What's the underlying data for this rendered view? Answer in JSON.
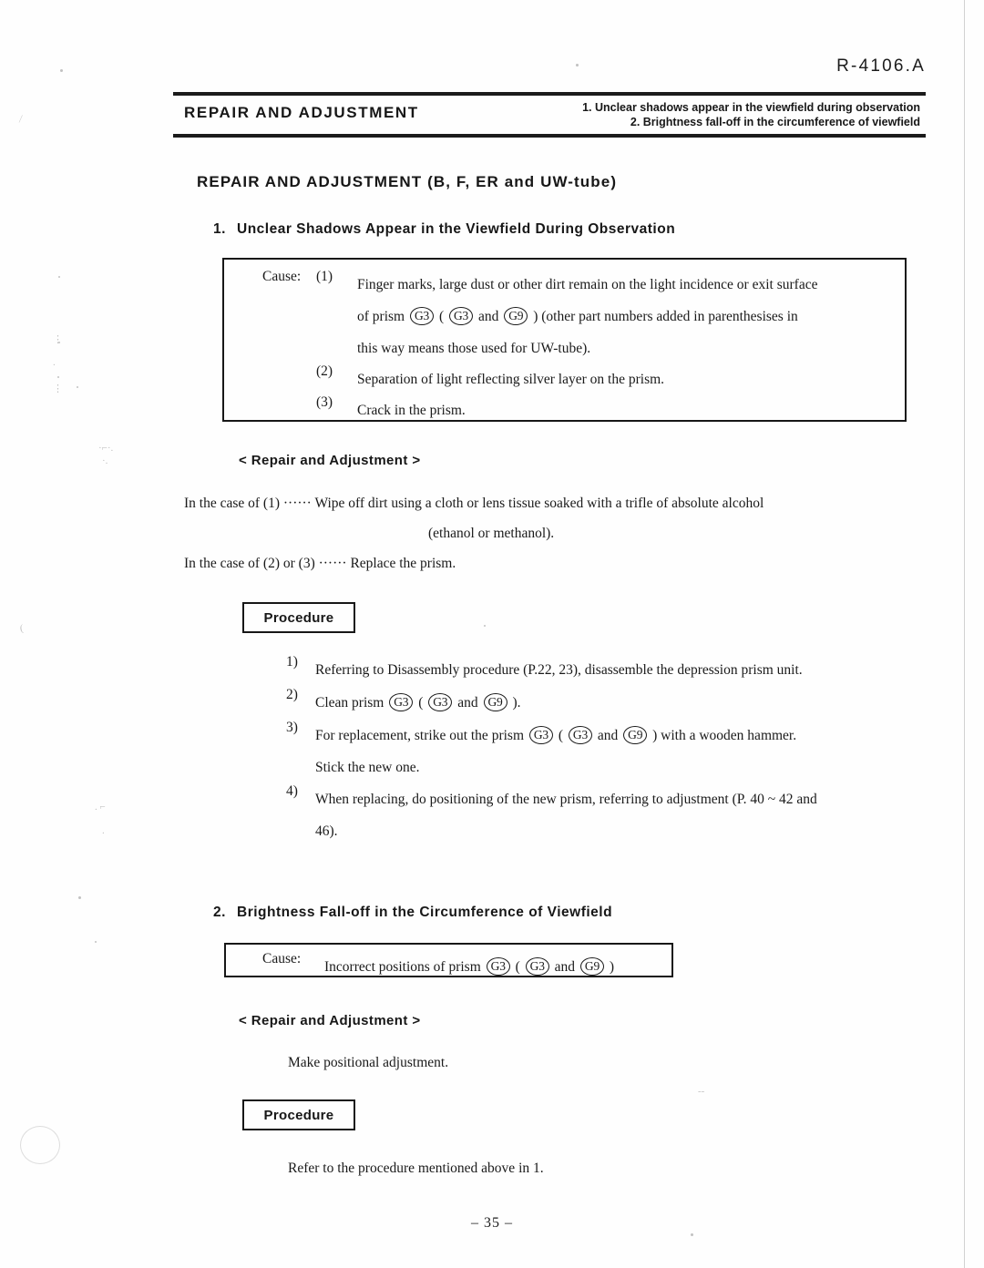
{
  "document": {
    "code": "R-4106.A",
    "page_number": "– 35 –"
  },
  "header": {
    "left_title": "REPAIR  AND  ADJUSTMENT",
    "right_line1": "1. Unclear shadows appear in the viewfield during observation",
    "right_line2": "2. Brightness fall-off in the circumference of viewfield"
  },
  "main_heading": "REPAIR  AND  ADJUSTMENT  (B, F, ER and UW-tube)",
  "section1": {
    "number": "1.",
    "title": "Unclear Shadows Appear in the Viewfield During Observation",
    "cause_box": {
      "label": "Cause:",
      "items": [
        {
          "marker": "(1)",
          "line1_a": "Finger marks, large dust or other dirt remain on the light incidence or exit surface",
          "line2_a": "of prism",
          "line2_g1": "G3",
          "line2_b": "(",
          "line2_g2": "G3",
          "line2_c": "and",
          "line2_g3": "G9",
          "line2_d": ") (other part numbers added in parenthesises in",
          "line3_a": "this way means those used for UW-tube)."
        },
        {
          "marker": "(2)",
          "line1_a": "Separation of light reflecting silver layer on the prism."
        },
        {
          "marker": "(3)",
          "line1_a": "Crack in the prism."
        }
      ]
    },
    "repair_heading": "< Repair and Adjustment >",
    "repair_line1": "In the case of (1) ······ Wipe off dirt using a cloth or lens tissue soaked with a trifle of absolute alcohol",
    "repair_line2": "(ethanol or methanol).",
    "repair_line3": "In the case of (2) or (3) ······ Replace the prism.",
    "procedure_label": "Procedure",
    "procedure_steps": [
      {
        "marker": "1)",
        "line1_a": "Referring to Disassembly procedure (P.22, 23), disassemble the depression prism unit."
      },
      {
        "marker": "2)",
        "line1_a": "Clean prism",
        "g1": "G3",
        "mid1": "(",
        "g2": "G3",
        "mid2": "and",
        "g3": "G9",
        "tail": ")."
      },
      {
        "marker": "3)",
        "line1_a": "For replacement, strike out the prism",
        "g1": "G3",
        "mid1": "(",
        "g2": "G3",
        "mid2": "and",
        "g3": "G9",
        "tail": ") with a wooden hammer.",
        "line2_a": "Stick the new one."
      },
      {
        "marker": "4)",
        "line1_a": "When replacing, do positioning of the new prism, referring to adjustment (P. 40 ~ 42 and",
        "line2_a": "46)."
      }
    ]
  },
  "section2": {
    "number": "2.",
    "title": "Brightness Fall-off in the Circumference of Viewfield",
    "cause_box": {
      "label": "Cause:",
      "text_a": "Incorrect positions of prism",
      "g1": "G3",
      "mid1": "(",
      "g2": "G3",
      "mid2": "and",
      "g3": "G9",
      "tail": ")"
    },
    "repair_heading": "< Repair and Adjustment >",
    "repair_text": "Make positional adjustment.",
    "procedure_label": "Procedure",
    "procedure_text": "Refer to the procedure mentioned above in 1."
  }
}
